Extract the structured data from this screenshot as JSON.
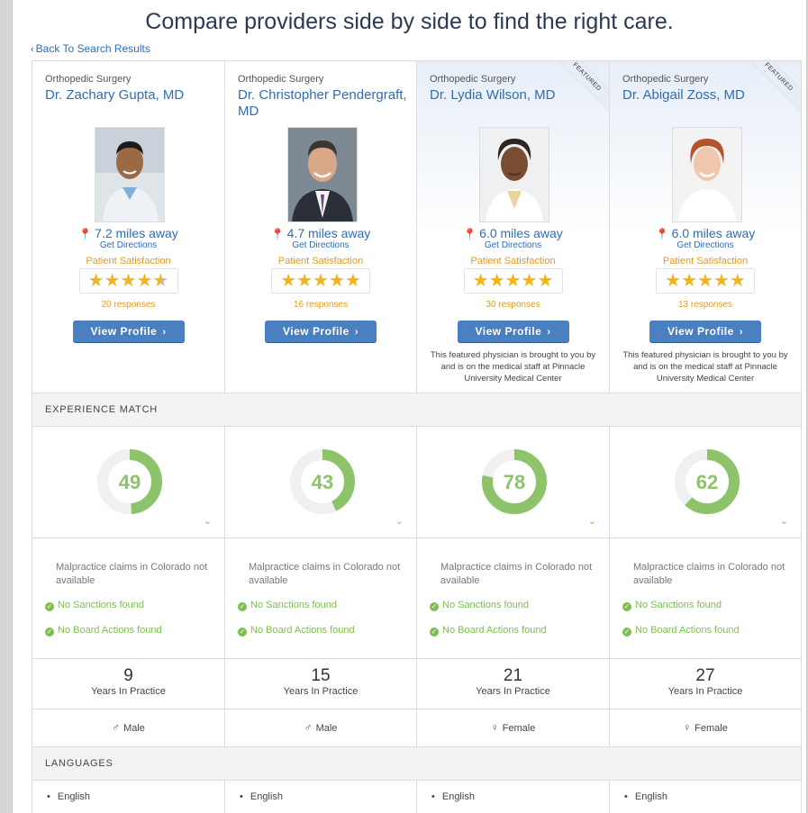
{
  "page": {
    "title": "Compare providers side by side to find the right care.",
    "back_link": "Back To Search Results"
  },
  "sections": {
    "experience": "EXPERIENCE MATCH",
    "languages": "LANGUAGES"
  },
  "colors": {
    "link": "#2e6db5",
    "star": "#f1b41b",
    "satisfaction": "#e39b1a",
    "button": "#4a7fc0",
    "ring": "#8dc36a",
    "check": "#7dbf4d"
  },
  "labels": {
    "get_directions": "Get Directions",
    "patient_satisfaction": "Patient Satisfaction",
    "view_profile": "View Profile",
    "years_in_practice": "Years In Practice",
    "featured": "FEATURED"
  },
  "providers": [
    {
      "specialty": "Orthopedic Surgery",
      "name": "Dr. Zachary Gupta, MD",
      "distance": "7.2 miles away",
      "rating": 4.5,
      "responses": "20 responses",
      "featured": false,
      "featured_note": "",
      "score": 49,
      "malpractice": "Malpractice claims in Colorado not available",
      "sanctions": "No Sanctions found",
      "board": "No Board Actions found",
      "years": "9",
      "gender": "Male",
      "language": "English"
    },
    {
      "specialty": "Orthopedic Surgery",
      "name": "Dr. Christopher Pendergraft, MD",
      "distance": "4.7 miles away",
      "rating": 5,
      "responses": "16 responses",
      "featured": false,
      "featured_note": "",
      "score": 43,
      "malpractice": "Malpractice claims in Colorado not available",
      "sanctions": "No Sanctions found",
      "board": "No Board Actions found",
      "years": "15",
      "gender": "Male",
      "language": "English"
    },
    {
      "specialty": "Orthopedic Surgery",
      "name": "Dr. Lydia Wilson, MD",
      "distance": "6.0 miles away",
      "rating": 5,
      "responses": "30 responses",
      "featured": true,
      "featured_note": "This featured physician is brought to you by and is on the medical staff at Pinnacle University Medical Center",
      "score": 78,
      "malpractice": "Malpractice claims in Colorado not available",
      "sanctions": "No Sanctions found",
      "board": "No Board Actions found",
      "years": "21",
      "gender": "Female",
      "language": "English"
    },
    {
      "specialty": "Orthopedic Surgery",
      "name": "Dr. Abigail Zoss, MD",
      "distance": "6.0 miles away",
      "rating": 5,
      "responses": "13 responses",
      "featured": true,
      "featured_note": "This featured physician is brought to you by and is on the medical staff at Pinnacle University Medical Center",
      "score": 62,
      "malpractice": "Malpractice claims in Colorado not available",
      "sanctions": "No Sanctions found",
      "board": "No Board Actions found",
      "years": "27",
      "gender": "Female",
      "language": "English"
    }
  ]
}
